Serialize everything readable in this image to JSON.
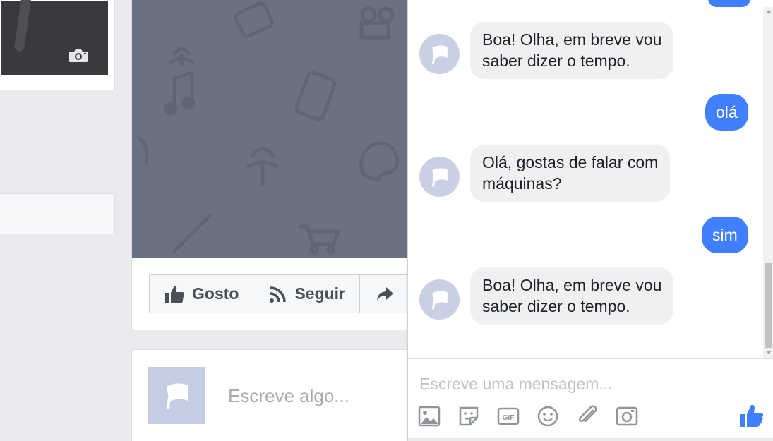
{
  "timeline": {
    "actions": [
      {
        "label": "Gosto",
        "icon": "thumbs-up-icon"
      },
      {
        "label": "Seguir",
        "icon": "rss-icon"
      },
      {
        "label": "",
        "icon": "share-arrow-icon"
      }
    ],
    "composer_placeholder": "Escreve algo..."
  },
  "chat": {
    "messages": [
      {
        "from": "bot",
        "text_line1": "Boa! Olha, em breve vou",
        "text_line2": "saber dizer o tempo."
      },
      {
        "from": "user",
        "text": "olá"
      },
      {
        "from": "bot",
        "text_line1": "Olá, gostas de falar com",
        "text_line2": "máquinas?"
      },
      {
        "from": "user",
        "text": "sim"
      },
      {
        "from": "bot",
        "text_line1": "Boa! Olha, em breve vou",
        "text_line2": "saber dizer o tempo."
      }
    ],
    "input_placeholder": "Escreve uma mensagem...",
    "toolbar": [
      "image-icon",
      "sticker-icon",
      "gif-icon",
      "emoji-icon",
      "attachment-icon",
      "camera-icon"
    ],
    "colors": {
      "user_bubble": "#4080ff",
      "bot_bubble": "#f1f0f0",
      "like": "#4080ff"
    }
  }
}
